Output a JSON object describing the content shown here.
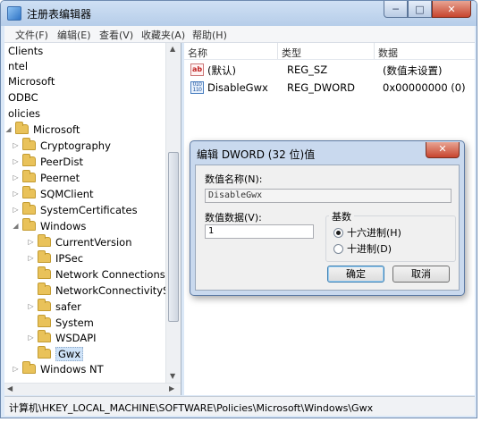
{
  "window": {
    "title": "注册表编辑器",
    "buttons": {
      "minimize": "─",
      "maximize": "□",
      "close": "✕"
    }
  },
  "menu": [
    "文件(F)",
    "编辑(E)",
    "查看(V)",
    "收藏夹(A)",
    "帮助(H)"
  ],
  "tree": [
    {
      "label": "Clients",
      "expander": ""
    },
    {
      "label": "ntel",
      "expander": ""
    },
    {
      "label": "Microsoft",
      "expander": ""
    },
    {
      "label": "ODBC",
      "expander": ""
    },
    {
      "label": "olicies",
      "expander": ""
    },
    {
      "label": "Microsoft",
      "expander": "◢",
      "folder": true
    },
    {
      "label": "Cryptography",
      "expander": "▷",
      "folder": true
    },
    {
      "label": "PeerDist",
      "expander": "▷",
      "folder": true
    },
    {
      "label": "Peernet",
      "expander": "▷",
      "folder": true
    },
    {
      "label": "SQMClient",
      "expander": "▷",
      "folder": true
    },
    {
      "label": "SystemCertificates",
      "expander": "▷",
      "folder": true
    },
    {
      "label": "Windows",
      "expander": "◢",
      "folder": true
    },
    {
      "label": "CurrentVersion",
      "expander": "▷",
      "folder": true
    },
    {
      "label": "IPSec",
      "expander": "▷",
      "folder": true
    },
    {
      "label": "Network Connections",
      "expander": "",
      "folder": true
    },
    {
      "label": "NetworkConnectivityStat",
      "expander": "",
      "folder": true
    },
    {
      "label": "safer",
      "expander": "▷",
      "folder": true
    },
    {
      "label": "System",
      "expander": "",
      "folder": true
    },
    {
      "label": "WSDAPI",
      "expander": "▷",
      "folder": true
    },
    {
      "label": "Gwx",
      "expander": "",
      "folder": true,
      "selected": true
    },
    {
      "label": "Windows NT",
      "expander": "▷",
      "folder": true
    }
  ],
  "columns": {
    "name": "名称",
    "type": "类型",
    "data": "数据"
  },
  "values": [
    {
      "icon": "ab",
      "name": "(默认)",
      "type": "REG_SZ",
      "data": "(数值未设置)"
    },
    {
      "icon": "010\n110",
      "name": "DisableGwx",
      "type": "REG_DWORD",
      "data": "0x00000000 (0)"
    }
  ],
  "status": "计算机\\HKEY_LOCAL_MACHINE\\SOFTWARE\\Policies\\Microsoft\\Windows\\Gwx",
  "dialog": {
    "title": "编辑 DWORD (32 位)值",
    "close": "✕",
    "name_label": "数值名称(N):",
    "name_value": "DisableGwx",
    "data_label": "数值数据(V):",
    "data_value": "1",
    "base_label": "基数",
    "hex_label": "十六进制(H)",
    "dec_label": "十进制(D)",
    "ok": "确定",
    "cancel": "取消"
  }
}
